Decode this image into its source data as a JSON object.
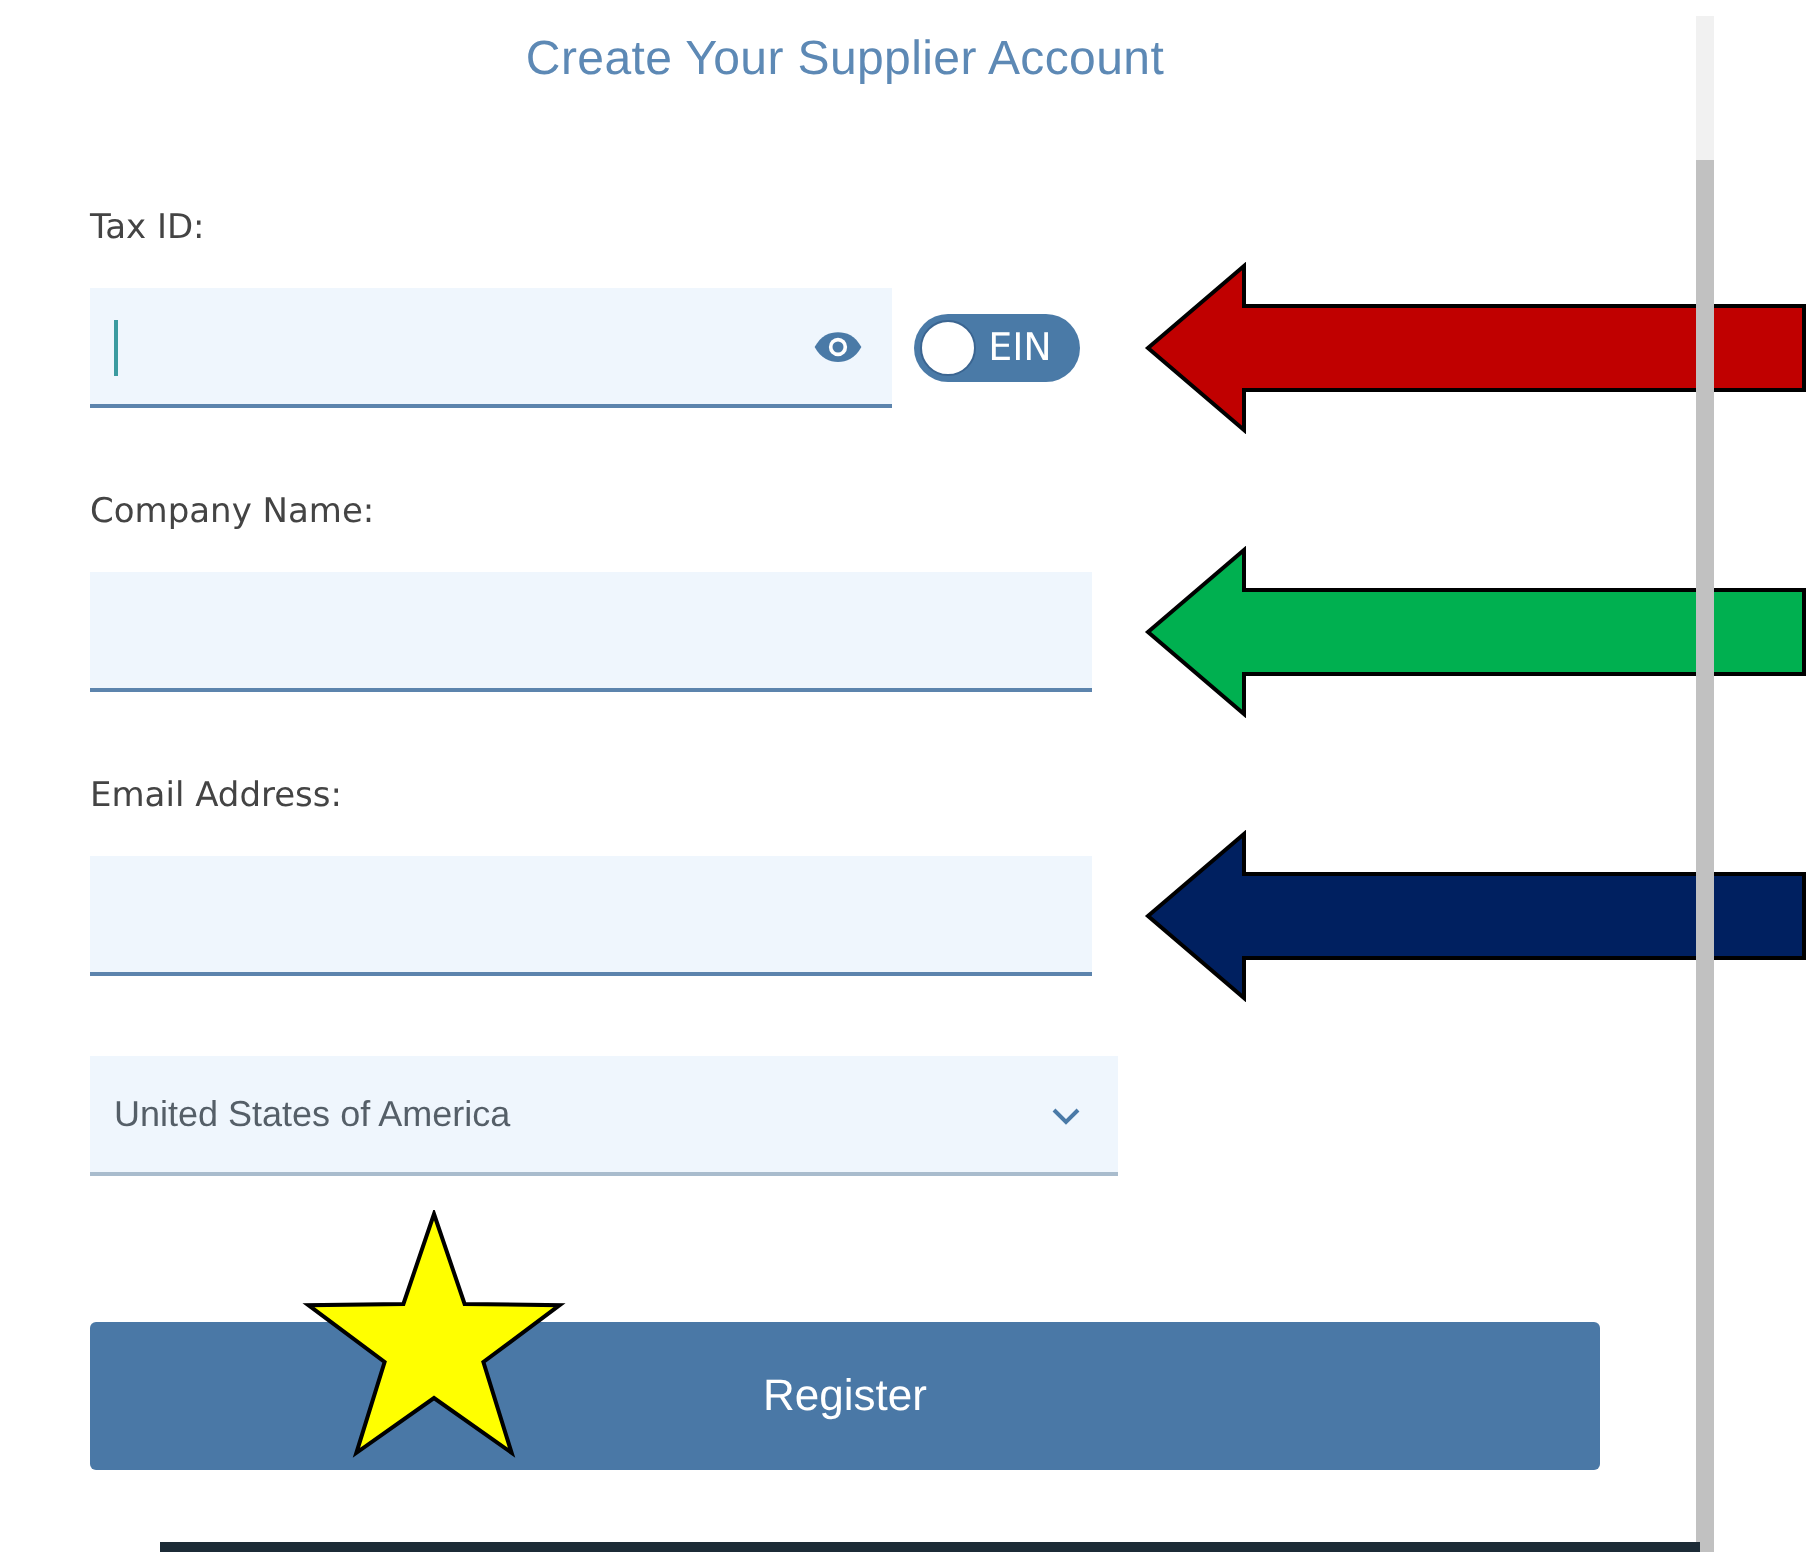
{
  "title": "Create Your Supplier Account",
  "fields": [
    {
      "kind": "secret",
      "label": "Tax ID:",
      "focused": true,
      "toggle": {
        "label": "EIN",
        "on": false
      },
      "arrow": {
        "color": "#c00000"
      }
    },
    {
      "kind": "text",
      "label": "Company Name:",
      "focused": false,
      "arrow": {
        "color": "#00b050"
      }
    },
    {
      "kind": "text",
      "label": "Email Address:",
      "focused": false,
      "arrow": {
        "color": "#002060"
      }
    },
    {
      "kind": "select",
      "value": "United States of America"
    }
  ],
  "button": {
    "label": "Register",
    "star": {
      "color": "#ffff00"
    }
  }
}
